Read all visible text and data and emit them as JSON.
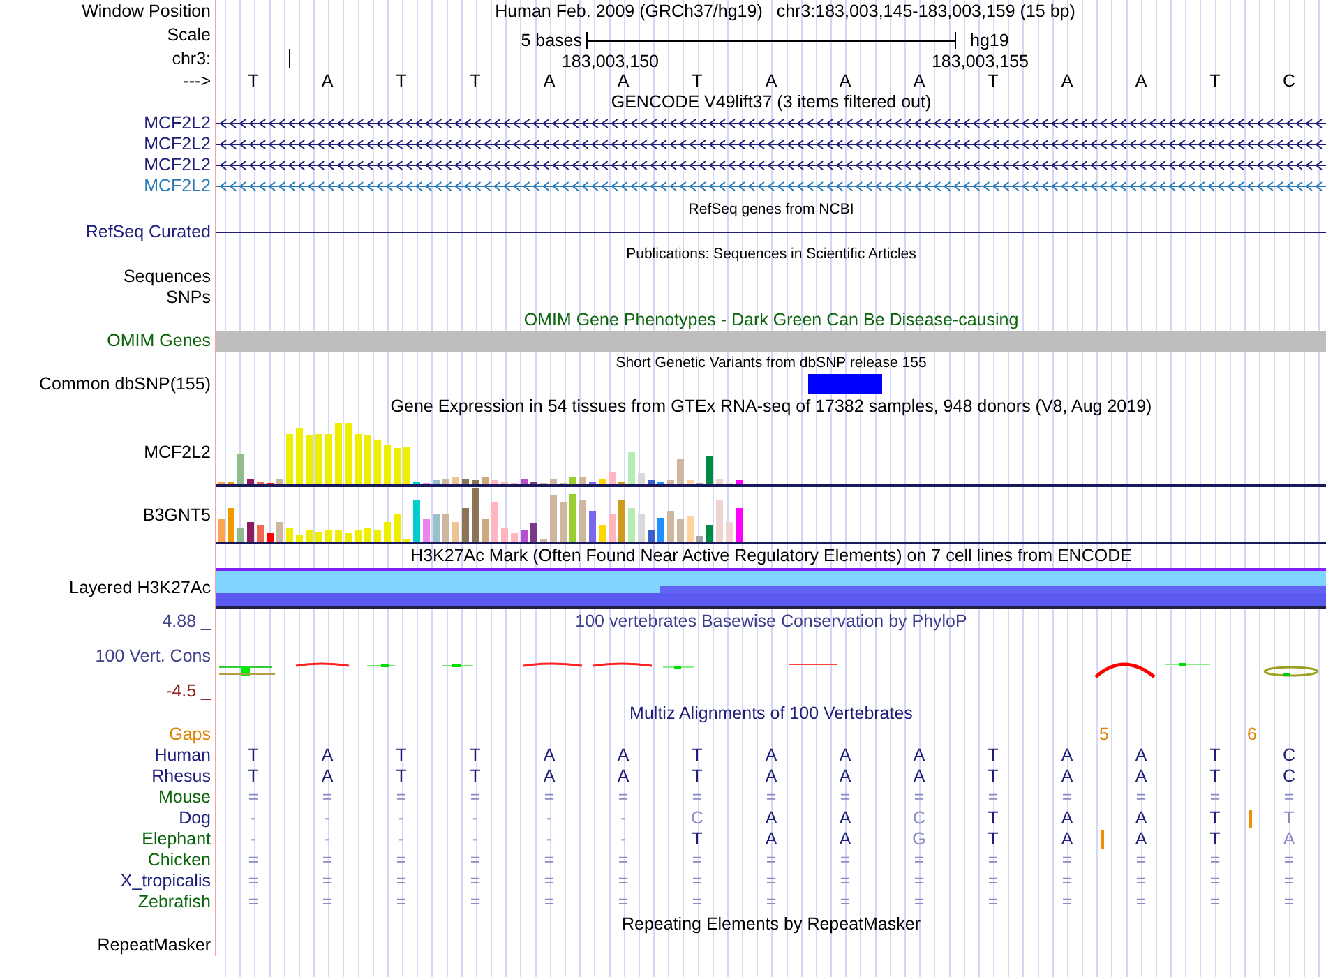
{
  "header": {
    "label": "Window Position",
    "assembly": "Human Feb. 2009 (GRCh37/hg19)",
    "position": "chr3:183,003,145-183,003,159 (15 bp)"
  },
  "scale": {
    "label": "Scale",
    "size": "5 bases",
    "db": "hg19"
  },
  "ruler": {
    "label": "chr3:",
    "ticks": [
      "183,003,150",
      "183,003,155"
    ]
  },
  "sequence": {
    "label": "--->",
    "bases": [
      "T",
      "A",
      "T",
      "T",
      "A",
      "A",
      "T",
      "A",
      "A",
      "A",
      "T",
      "A",
      "A",
      "T",
      "C"
    ]
  },
  "tracks": [
    {
      "kind": "gene",
      "title": "GENCODE V49lift37 (3 items filtered out)",
      "color": "#000000",
      "items": [
        {
          "label": "MCF2L2",
          "color": "#1e1e78"
        },
        {
          "label": "MCF2L2",
          "color": "#1e1e78"
        },
        {
          "label": "MCF2L2",
          "color": "#1e1e78"
        },
        {
          "label": "MCF2L2",
          "color": "#2a7ab8"
        }
      ]
    },
    {
      "kind": "line",
      "title": "RefSeq genes from NCBI",
      "color": "#000000",
      "items": [
        {
          "label": "RefSeq Curated",
          "color": "#1e1e78"
        }
      ]
    },
    {
      "kind": "labels",
      "title": "Publications: Sequences in Scientific Articles",
      "color": "#000000",
      "items": [
        {
          "label": "Sequences",
          "color": "#000000"
        },
        {
          "label": "SNPs",
          "color": "#000000"
        }
      ]
    },
    {
      "kind": "bar",
      "title": "OMIM Gene Phenotypes - Dark Green Can Be Disease-causing",
      "color": "#0a640a",
      "items": [
        {
          "label": "OMIM Genes",
          "color": "#0a640a"
        }
      ]
    },
    {
      "kind": "snp",
      "title": "Short Genetic Variants from dbSNP release 155",
      "color": "#000000",
      "items": [
        {
          "label": "Common dbSNP(155)",
          "color": "#000000"
        }
      ]
    },
    {
      "kind": "gtex",
      "title": "Gene Expression in 54 tissues from GTEx RNA-seq of 17382 samples, 948 donors (V8, Aug 2019)",
      "color": "#000000",
      "items": [
        {
          "label": "MCF2L2",
          "color": "#000000"
        },
        {
          "label": "B3GNT5",
          "color": "#000000"
        }
      ]
    },
    {
      "kind": "layered",
      "title": "H3K27Ac Mark (Often Found Near Active Regulatory Elements) on 7 cell lines from ENCODE",
      "color": "#000000",
      "items": [
        {
          "label": "Layered H3K27Ac",
          "color": "#000000"
        }
      ]
    },
    {
      "kind": "phylop",
      "title": "100 vertebrates Basewise Conservation by PhyloP",
      "color": "#3c3c8c",
      "max": "4.88 _",
      "min": "-4.5 _",
      "items": [
        {
          "label": "100 Vert. Cons",
          "color": "#40408a"
        }
      ]
    },
    {
      "kind": "multiz",
      "title": "Multiz Alignments of 100 Vertebrates",
      "color": "#1e1e78",
      "gaps": {
        "label": "Gaps",
        "cells": [
          null,
          null,
          null,
          null,
          null,
          null,
          null,
          null,
          null,
          null,
          null,
          "5",
          null,
          "6",
          null
        ]
      },
      "items": [
        {
          "label": "Human",
          "color": "#1e1e78",
          "bases": [
            "T",
            "A",
            "T",
            "T",
            "A",
            "A",
            "T",
            "A",
            "A",
            "A",
            "T",
            "A",
            "A",
            "T",
            "C"
          ]
        },
        {
          "label": "Rhesus",
          "color": "#1e1e78",
          "bases": [
            "T",
            "A",
            "T",
            "T",
            "A",
            "A",
            "T",
            "A",
            "A",
            "A",
            "T",
            "A",
            "A",
            "T",
            "C"
          ]
        },
        {
          "label": "Mouse",
          "color": "#0a640a",
          "bases": [
            "=",
            "=",
            "=",
            "=",
            "=",
            "=",
            "=",
            "=",
            "=",
            "=",
            "=",
            "=",
            "=",
            "=",
            "="
          ]
        },
        {
          "label": "Dog",
          "color": "#1e1e78",
          "bases": [
            "-",
            "-",
            "-",
            "-",
            "-",
            "-",
            "C",
            "A",
            "A",
            "C",
            "T",
            "A",
            "A",
            "T",
            "T"
          ],
          "inserts": [
            false,
            false,
            false,
            false,
            false,
            false,
            false,
            false,
            false,
            false,
            false,
            false,
            false,
            true,
            false
          ]
        },
        {
          "label": "Elephant",
          "color": "#0a640a",
          "bases": [
            "-",
            "-",
            "-",
            "-",
            "-",
            "-",
            "T",
            "A",
            "A",
            "G",
            "T",
            "A",
            "A",
            "T",
            "A"
          ],
          "inserts": [
            false,
            false,
            false,
            false,
            false,
            false,
            false,
            false,
            false,
            false,
            false,
            true,
            false,
            false,
            false
          ]
        },
        {
          "label": "Chicken",
          "color": "#0a640a",
          "bases": [
            "=",
            "=",
            "=",
            "=",
            "=",
            "=",
            "=",
            "=",
            "=",
            "=",
            "=",
            "=",
            "=",
            "=",
            "="
          ]
        },
        {
          "label": "X_tropicalis",
          "color": "#1e1e78",
          "bases": [
            "=",
            "=",
            "=",
            "=",
            "=",
            "=",
            "=",
            "=",
            "=",
            "=",
            "=",
            "=",
            "=",
            "=",
            "="
          ]
        },
        {
          "label": "Zebrafish",
          "color": "#0a640a",
          "bases": [
            "=",
            "=",
            "=",
            "=",
            "=",
            "=",
            "=",
            "=",
            "=",
            "=",
            "=",
            "=",
            "=",
            "=",
            "="
          ]
        }
      ]
    },
    {
      "kind": "empty",
      "title": "Repeating Elements by RepeatMasker",
      "color": "#000000",
      "items": [
        {
          "label": "RepeatMasker",
          "color": "#000000"
        }
      ]
    }
  ]
}
